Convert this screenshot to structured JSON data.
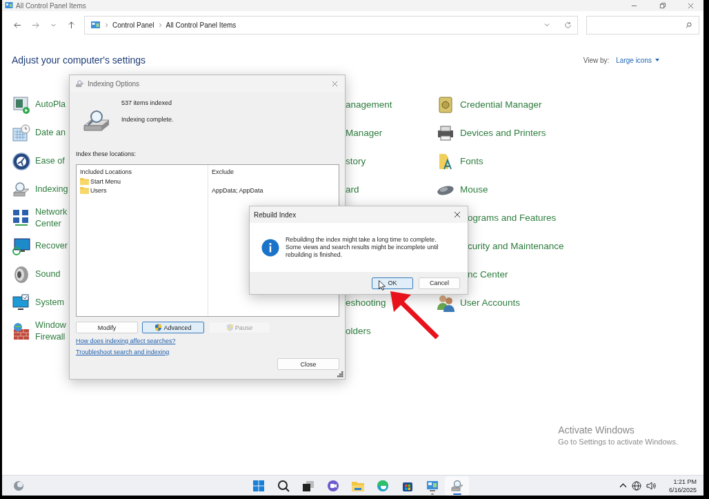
{
  "window": {
    "title": "All Control Panel Items"
  },
  "address_bar": {
    "crumbs": [
      "Control Panel",
      "All Control Panel Items"
    ]
  },
  "header": {
    "title": "Adjust your computer's settings",
    "view_by_label": "View by:",
    "view_by_value": "Large icons"
  },
  "panel_items": {
    "column_1": [
      {
        "label": "AutoPla",
        "kind": "full"
      },
      {
        "label": "Date an",
        "kind": "full"
      },
      {
        "label": "Ease of",
        "kind": "full"
      },
      {
        "label": "Indexing",
        "kind": "full"
      },
      {
        "label": "Network Center",
        "kind": "full"
      },
      {
        "label": "Recover",
        "kind": "full"
      },
      {
        "label": "Sound",
        "kind": "full"
      },
      {
        "label": "System",
        "kind": "full"
      },
      {
        "label": "Window Firewall",
        "kind": "full"
      }
    ],
    "column_2_upper": [
      {
        "label": "anagement",
        "kind": "cut"
      },
      {
        "label": "Manager",
        "kind": "cut"
      },
      {
        "label": "story",
        "kind": "cut"
      },
      {
        "label": "ard",
        "kind": "cut"
      }
    ],
    "column_2_lower": [
      {
        "label": "eshooting",
        "kind": "cut"
      },
      {
        "label": "olders",
        "kind": "cut"
      }
    ],
    "column_3": [
      {
        "label": "Credential Manager",
        "kind": "full"
      },
      {
        "label": "Devices and Printers",
        "kind": "full"
      },
      {
        "label": "Fonts",
        "kind": "full"
      },
      {
        "label": "Mouse",
        "kind": "full"
      },
      {
        "label": "ograms and Features",
        "kind": "cut"
      },
      {
        "label": "curity and Maintenance",
        "kind": "cut"
      },
      {
        "label": "nc Center",
        "kind": "cut"
      },
      {
        "label": "User Accounts",
        "kind": "full"
      }
    ]
  },
  "indexing_dialog": {
    "title": "Indexing Options",
    "count": "537 items indexed",
    "status": "Indexing complete.",
    "locations_label": "Index these locations:",
    "columns": [
      "Included Locations",
      "Exclude"
    ],
    "rows": [
      {
        "location": "Start Menu"
      },
      {
        "location": "Users",
        "exclude": "AppData; AppData"
      }
    ],
    "buttons": [
      {
        "label": "Modify",
        "shield": false,
        "focused": false,
        "disabled": false
      },
      {
        "label": "Advanced",
        "shield": true,
        "focused": true,
        "disabled": false
      },
      {
        "label": "Pause",
        "shield": true,
        "focused": false,
        "disabled": true
      }
    ],
    "links": [
      "How does indexing affect searches?",
      "Troubleshoot search and indexing"
    ],
    "close_button": "Close"
  },
  "rebuild_dialog": {
    "title": "Rebuild Index",
    "message": "Rebuilding the index might take a long time to complete. Some views and search results might be incomplete until rebuilding is finished.",
    "buttons": [
      {
        "label": "OK",
        "focused": true
      },
      {
        "label": "Cancel",
        "focused": false
      }
    ]
  },
  "activation_notice": {
    "title": "Activate Windows",
    "subtitle": "Go to Settings to activate Windows."
  },
  "taskbar": {
    "apps": [
      {
        "running": false,
        "active": false
      },
      {
        "running": false,
        "active": false
      },
      {
        "running": false,
        "active": false
      },
      {
        "running": false,
        "active": false
      },
      {
        "running": false,
        "active": false
      },
      {
        "running": false,
        "active": false
      },
      {
        "running": false,
        "active": false
      },
      {
        "running": true,
        "active": false
      },
      {
        "running": true,
        "active": true
      }
    ],
    "time": "1:21 PM",
    "date": "6/16/2025"
  }
}
